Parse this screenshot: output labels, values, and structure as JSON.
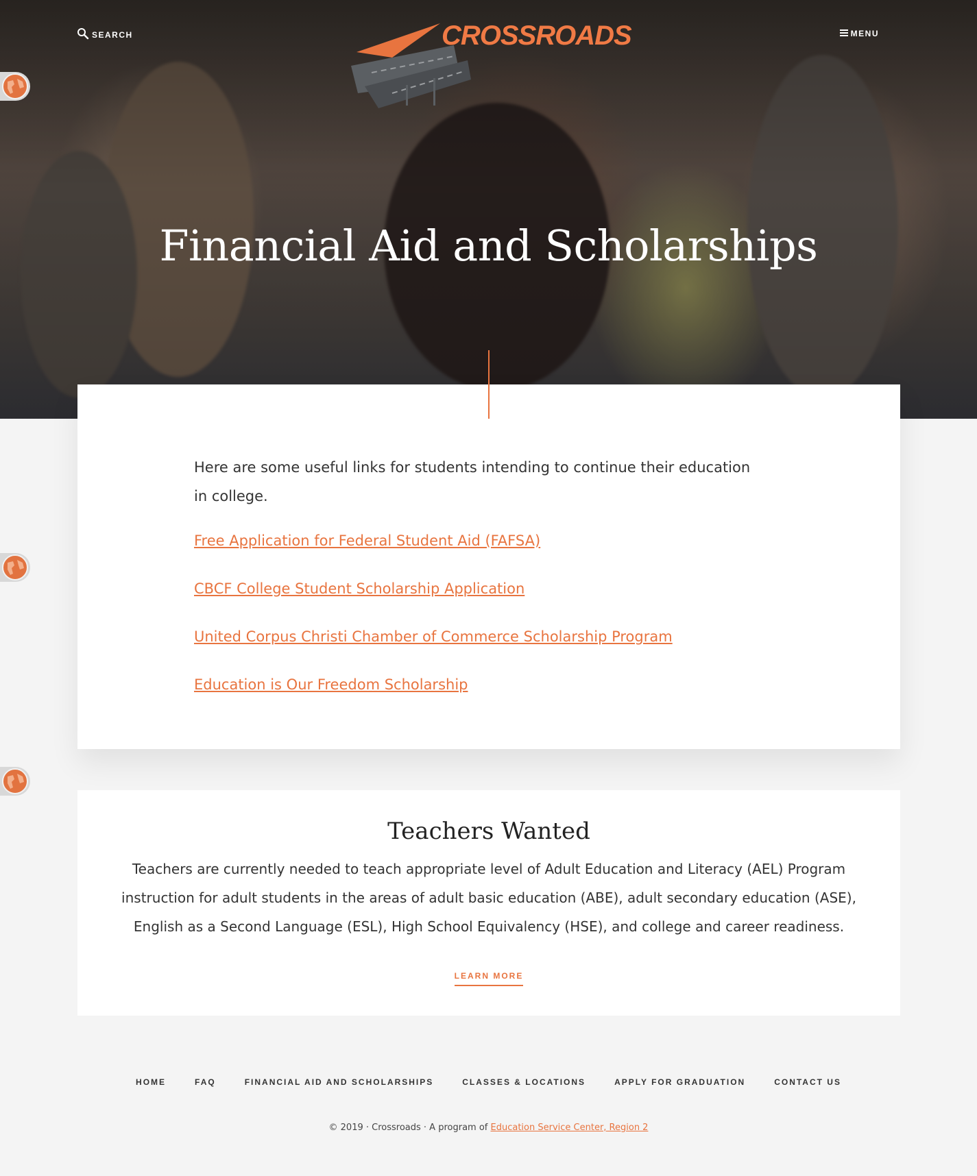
{
  "header": {
    "search_label": "SEARCH",
    "menu_label": "MENU",
    "logo_text": "CROSSROADS"
  },
  "hero": {
    "title": "Financial Aid and Scholarships"
  },
  "content": {
    "intro": "Here are some useful links for students intending to continue their education in college.",
    "links": [
      {
        "label": "Free Application for Federal Student Aid (FAFSA)"
      },
      {
        "label": "CBCF College Student Scholarship Application "
      },
      {
        "label": "United Corpus Christi Chamber of Commerce Scholarship Program"
      },
      {
        "label": "Education is Our Freedom Scholarship"
      }
    ]
  },
  "teachers": {
    "title": "Teachers Wanted",
    "body": "Teachers are currently needed to teach appropriate level of Adult Education and Literacy (AEL) Program instruction for adult students in the areas of adult basic education (ABE), adult secondary education (ASE), English as a Second Language (ESL), High School Equivalency (HSE), and college and career readiness.",
    "cta": "LEARN MORE"
  },
  "footer": {
    "nav": [
      "HOME",
      "FAQ",
      "FINANCIAL AID AND SCHOLARSHIPS",
      "CLASSES & LOCATIONS",
      "APPLY FOR GRADUATION",
      "CONTACT US"
    ],
    "copyright_prefix": "© 2019 · Crossroads · A program of ",
    "copyright_link": "Education Service Center, Region 2"
  },
  "colors": {
    "accent": "#e8743f",
    "background": "#f4f4f4"
  },
  "icons": [
    "search-icon",
    "menu-icon",
    "globe-icon"
  ]
}
